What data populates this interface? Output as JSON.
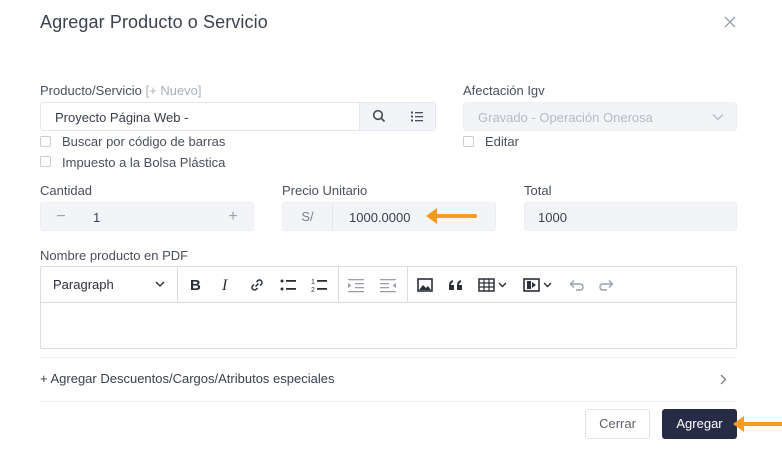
{
  "modal": {
    "title": "Agregar Producto o Servicio"
  },
  "product": {
    "label": "Producto/Servicio",
    "new_link": "[+ Nuevo]",
    "value": "Proyecto Página Web -"
  },
  "igv": {
    "label": "Afectación Igv",
    "value": "Gravado - Operación Onerosa",
    "edit_label": "Editar"
  },
  "checkboxes": {
    "barcode": "Buscar por código de barras",
    "bag_tax": "Impuesto a la Bolsa Plástica"
  },
  "quantity": {
    "label": "Cantidad",
    "value": "1",
    "minus": "−",
    "plus": "+"
  },
  "price": {
    "label": "Precio Unitario",
    "prefix": "S/",
    "value": "1000.0000"
  },
  "total": {
    "label": "Total",
    "value": "1000"
  },
  "pdf_name": {
    "label": "Nombre producto en PDF",
    "format_select": "Paragraph"
  },
  "extras": {
    "label": "+ Agregar Descuentos/Cargos/Atributos especiales"
  },
  "footer": {
    "close_label": "Cerrar",
    "add_label": "Agregar"
  },
  "annotations": {
    "arrow_color": "#f59a23"
  },
  "icons": [
    "close-icon",
    "search-icon",
    "list-icon",
    "chevron-down-icon",
    "bold-icon",
    "italic-icon",
    "link-icon",
    "bullet-list-icon",
    "numbered-list-icon",
    "outdent-icon",
    "indent-icon",
    "image-icon",
    "quote-icon",
    "table-icon",
    "media-icon",
    "undo-icon",
    "redo-icon",
    "chevron-right-icon",
    "arrow-annotation-icon"
  ]
}
